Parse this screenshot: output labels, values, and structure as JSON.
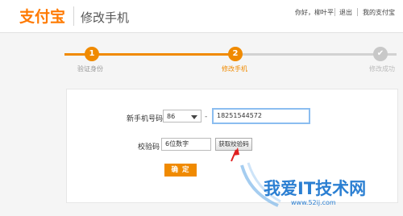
{
  "header": {
    "logo_text": "支付宝",
    "title": "修改手机",
    "nav": {
      "greeting": "你好，柳叶平",
      "logout": "退出",
      "my_alipay": "我的支付宝"
    }
  },
  "steps": [
    {
      "number": "1",
      "label": "验证身份",
      "state": "done"
    },
    {
      "number": "2",
      "label": "修改手机",
      "state": "current"
    },
    {
      "number": "✔",
      "label": "修改成功",
      "state": "pending"
    }
  ],
  "form": {
    "phone_label": "新手机号码",
    "country_code": "86",
    "dash": "-",
    "phone_value": "18251544572",
    "code_label": "校验码",
    "code_placeholder": "6位数字",
    "get_code_button": "获取校验码",
    "confirm_button": "确 定"
  },
  "watermark": {
    "text": "我爱IT技术网",
    "url": "www.52ij.com"
  },
  "colors": {
    "brand_orange": "#f08a00",
    "step_gray": "#c8c8c8",
    "focus_blue": "#8bbdf0",
    "watermark_blue": "#2b7fd2"
  }
}
